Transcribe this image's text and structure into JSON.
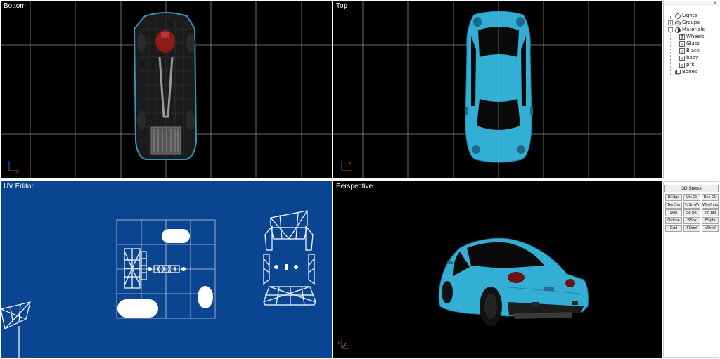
{
  "viewports": {
    "bottom": {
      "title": "Bottom"
    },
    "top": {
      "title": "Top"
    },
    "uv": {
      "title": "UV Editor"
    },
    "perspective": {
      "title": "Perspective"
    }
  },
  "scene_tree": {
    "lights": "Lights",
    "groups": "Groups",
    "materials": "Materials",
    "material_items": [
      "Wheels",
      "Glass",
      "Black",
      "body",
      "prk"
    ],
    "bones": "Bones"
  },
  "states": {
    "header": "3D States",
    "buttons": [
      [
        "BEdge",
        "Vtx Clr",
        "Bne Clr"
      ],
      [
        "Tex Sm",
        "TxSmWr",
        "Wirefrme"
      ],
      [
        "Skel",
        "Sd Bkf",
        "Inc Bkf"
      ],
      [
        "Outline",
        "BBox",
        "BSphr"
      ],
      [
        "Grid",
        "FNrml",
        "VNrml"
      ]
    ]
  },
  "colors": {
    "viewport_bg": "#000000",
    "uv_bg": "#0a4592",
    "car_body": "#33aed4",
    "grid_line": "#8a8a8a"
  }
}
